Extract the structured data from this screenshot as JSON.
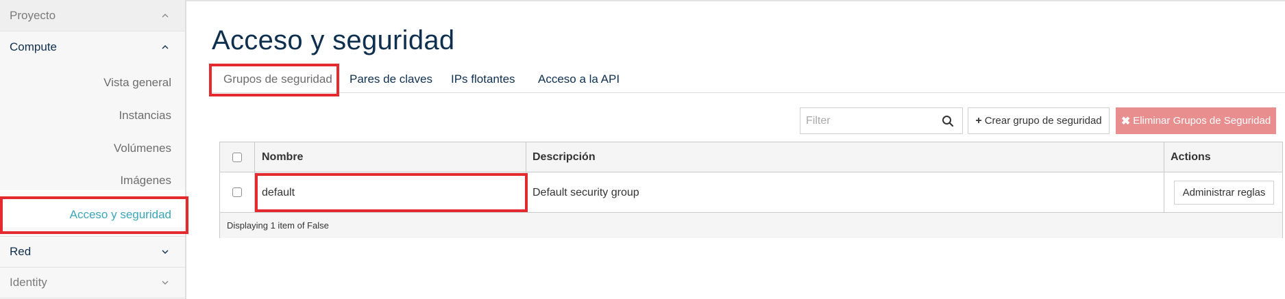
{
  "sidebar": {
    "sections": {
      "proyecto": "Proyecto",
      "compute": "Compute",
      "red": "Red",
      "identity": "Identity"
    },
    "compute_items": [
      {
        "label": "Vista general"
      },
      {
        "label": "Instancias"
      },
      {
        "label": "Volúmenes"
      },
      {
        "label": "Imágenes"
      },
      {
        "label": "Acceso y seguridad",
        "active": true
      }
    ]
  },
  "main": {
    "title": "Acceso y seguridad",
    "tabs": [
      {
        "label": "Grupos de seguridad",
        "active": true
      },
      {
        "label": "Pares de claves"
      },
      {
        "label": "IPs flotantes"
      },
      {
        "label": "Acceso a la API"
      }
    ]
  },
  "toolbar": {
    "filter_placeholder": "Filter",
    "create_label": "Crear grupo de seguridad",
    "delete_label": "Eliminar Grupos de Seguridad"
  },
  "table": {
    "columns": [
      "Nombre",
      "Descripción",
      "Actions"
    ],
    "rows": [
      {
        "name": "default",
        "description": "Default security group",
        "action": "Administrar reglas"
      }
    ],
    "footer": "Displaying 1 item of False"
  },
  "colors": {
    "title": "#0f2f4f",
    "active_link": "#3aa5b8",
    "highlight": "#e52a2f",
    "danger_button": "#e88e8e"
  }
}
